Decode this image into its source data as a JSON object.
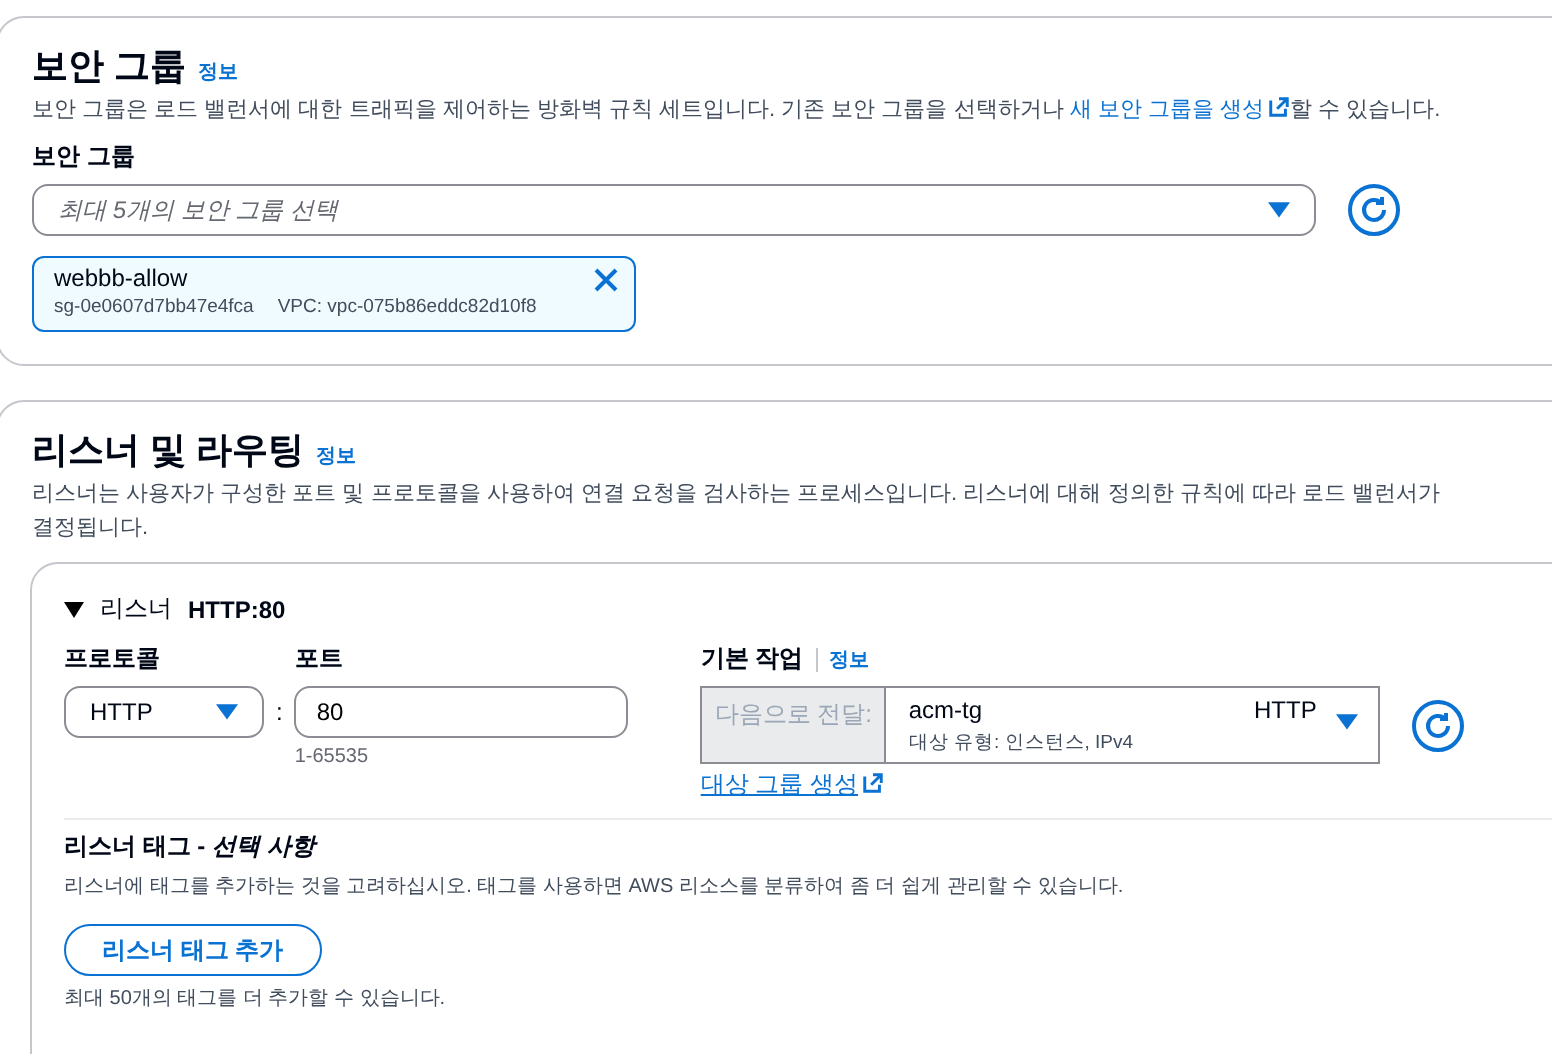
{
  "security_group": {
    "title": "보안 그룹",
    "info": "정보",
    "description_before": "보안 그룹은 로드 밸런서에 대한 트래픽을 제어하는 방화벽 규칙 세트입니다. 기존 보안 그룹을 선택하거나 ",
    "description_link": "새 보안 그룹을 생성",
    "description_after": "할 수 있습니다.",
    "field_label": "보안 그룹",
    "select_placeholder": "최대 5개의 보안 그룹 선택",
    "tokens": [
      {
        "name": "webbb-allow",
        "id": "sg-0e0607d7bb47e4fca",
        "vpc": "VPC: vpc-075b86eddc82d10f8"
      }
    ]
  },
  "listeners_routing": {
    "title": "리스너 및 라우팅",
    "info": "정보",
    "description_lines": [
      "리스너는 사용자가 구성한 포트 및 프로토콜을 사용하여 연결 요청을 검사하는 프로세스입니다. 리스너에 대해 정의한 규칙에 따라 로드 밸런서가",
      "결정됩니다."
    ],
    "listener": {
      "expanded": true,
      "label": "리스너",
      "name": "HTTP:80",
      "protocol_label": "프로토콜",
      "protocol": "HTTP",
      "separator": ":",
      "port_label": "포트",
      "port": "80",
      "port_hint": "1-65535",
      "action_label": "기본 작업",
      "action_info": "정보",
      "action_prefix": "다음으로 전달:",
      "target_group": "acm-tg",
      "target_protocol": "HTTP",
      "target_detail": "대상 유형: 인스턴스, IPv4",
      "create_target_link": "대상 그룹 생성",
      "tags_title": "리스너 태그 - ",
      "tags_title_optional": "선택 사항",
      "tags_description": "리스너에 태그를 추가하는 것을 고려하십시오. 태그를 사용하면 AWS 리소스를 분류하여 좀 더 쉽게 관리할 수 있습니다.",
      "add_tag_button": "리스너 태그 추가",
      "tags_hint": "최대 50개의 태그를 더 추가할 수 있습니다."
    }
  }
}
